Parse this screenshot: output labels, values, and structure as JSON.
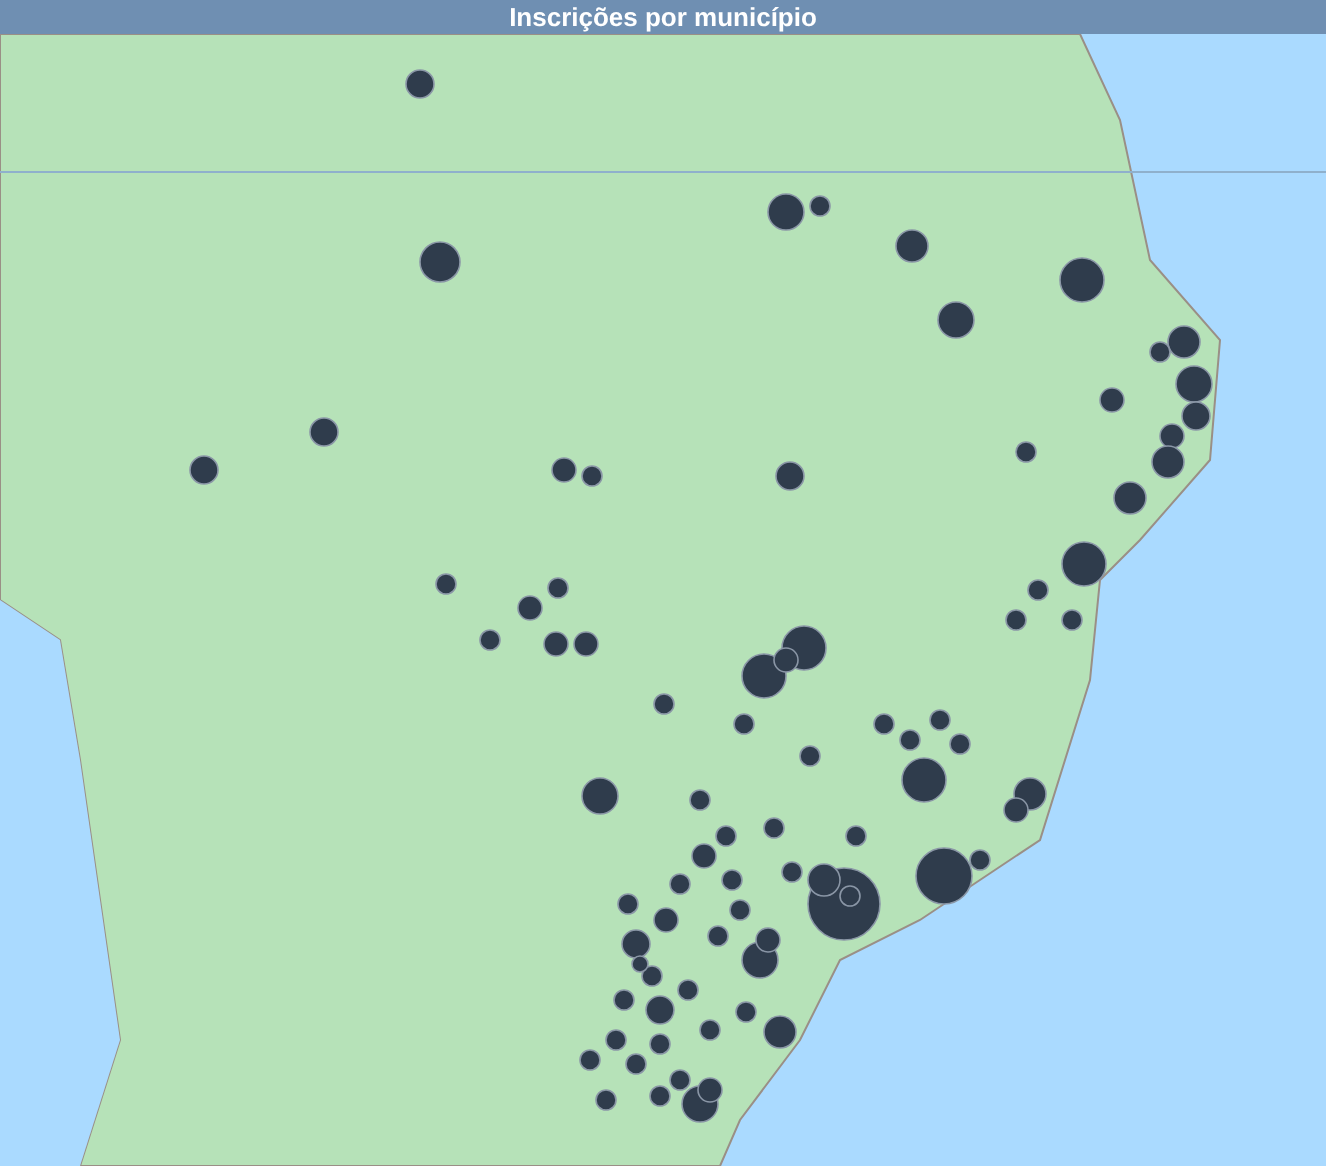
{
  "title": "Inscrições por município"
}
